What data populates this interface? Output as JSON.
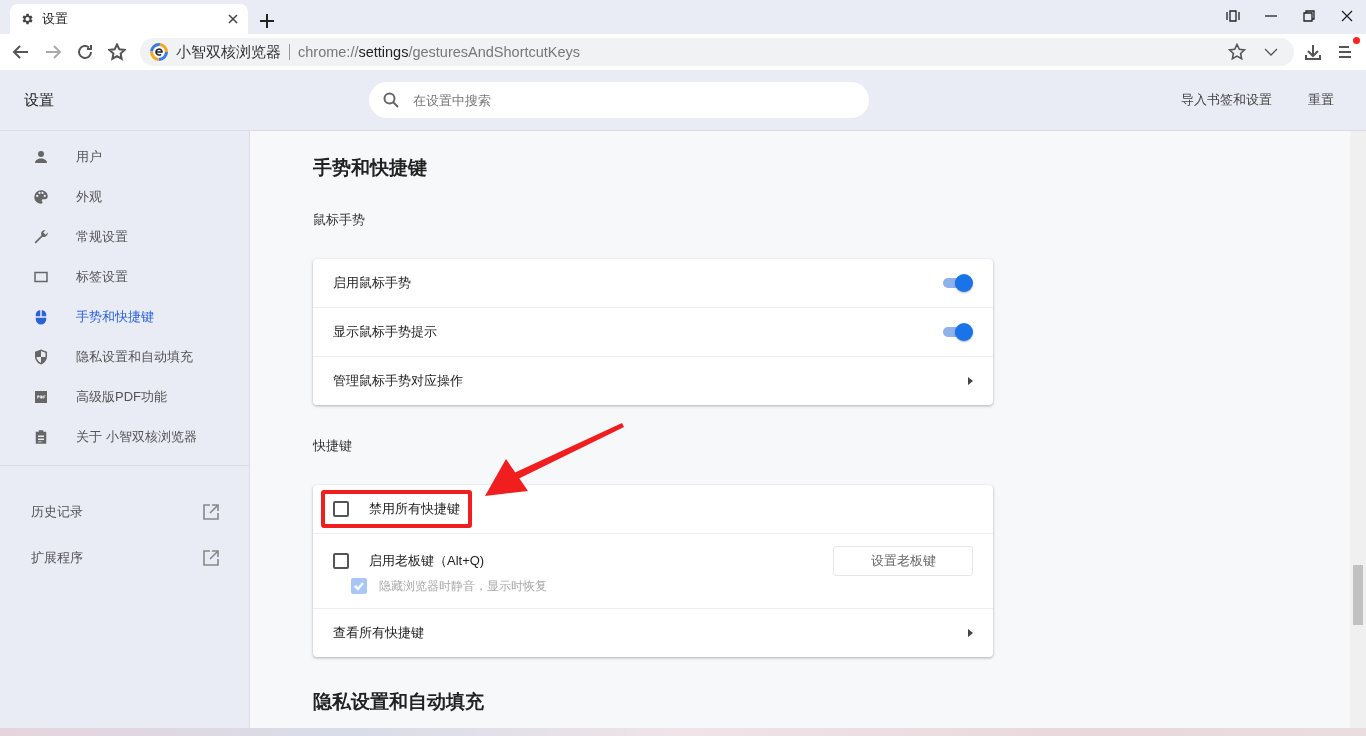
{
  "tabs": [
    {
      "title": "设置",
      "selected": true
    }
  ],
  "address": {
    "site_name": "小智双核浏览器",
    "url_scheme": "chrome://",
    "url_host": "settings",
    "url_path": "/gesturesAndShortcutKeys"
  },
  "header": {
    "title": "设置",
    "search": {
      "placeholder": "在设置中搜索"
    },
    "actions": [
      "导入书签和设置",
      "重置"
    ]
  },
  "sidebar": {
    "items": [
      {
        "label": "用户",
        "selected": false
      },
      {
        "label": "外观",
        "selected": false
      },
      {
        "label": "常规设置",
        "selected": false
      },
      {
        "label": "标签设置",
        "selected": false
      },
      {
        "label": "手势和快捷键",
        "selected": true
      },
      {
        "label": "隐私设置和自动填充",
        "selected": false
      },
      {
        "label": "高级版PDF功能",
        "selected": false
      },
      {
        "label": "关于 小智双核浏览器",
        "selected": false
      }
    ],
    "links": [
      "历史记录",
      "扩展程序"
    ]
  },
  "section": {
    "heading": "手势和快捷键",
    "groups": [
      {
        "title": "鼠标手势",
        "rows": [
          {
            "kind": "toggle",
            "label": "启用鼠标手势",
            "on": true
          },
          {
            "kind": "toggle",
            "label": "显示鼠标手势提示",
            "on": true
          },
          {
            "kind": "link",
            "label": "管理鼠标手势对应操作"
          }
        ]
      },
      {
        "title": "快捷键",
        "rows": [
          {
            "kind": "checkbox",
            "label": "禁用所有快捷键",
            "checked": false,
            "highlighted": true
          },
          {
            "kind": "checkbox",
            "label": "启用老板键（Alt+Q)",
            "checked": false,
            "highlighted": false,
            "button": "设置老板键",
            "sub": {
              "label": "隐藏浏览器时静音，显示时恢复",
              "checked": true,
              "disabled": true
            }
          },
          {
            "kind": "link",
            "label": "查看所有快捷键"
          }
        ]
      }
    ]
  },
  "next_heading": "隐私设置和自动填充"
}
